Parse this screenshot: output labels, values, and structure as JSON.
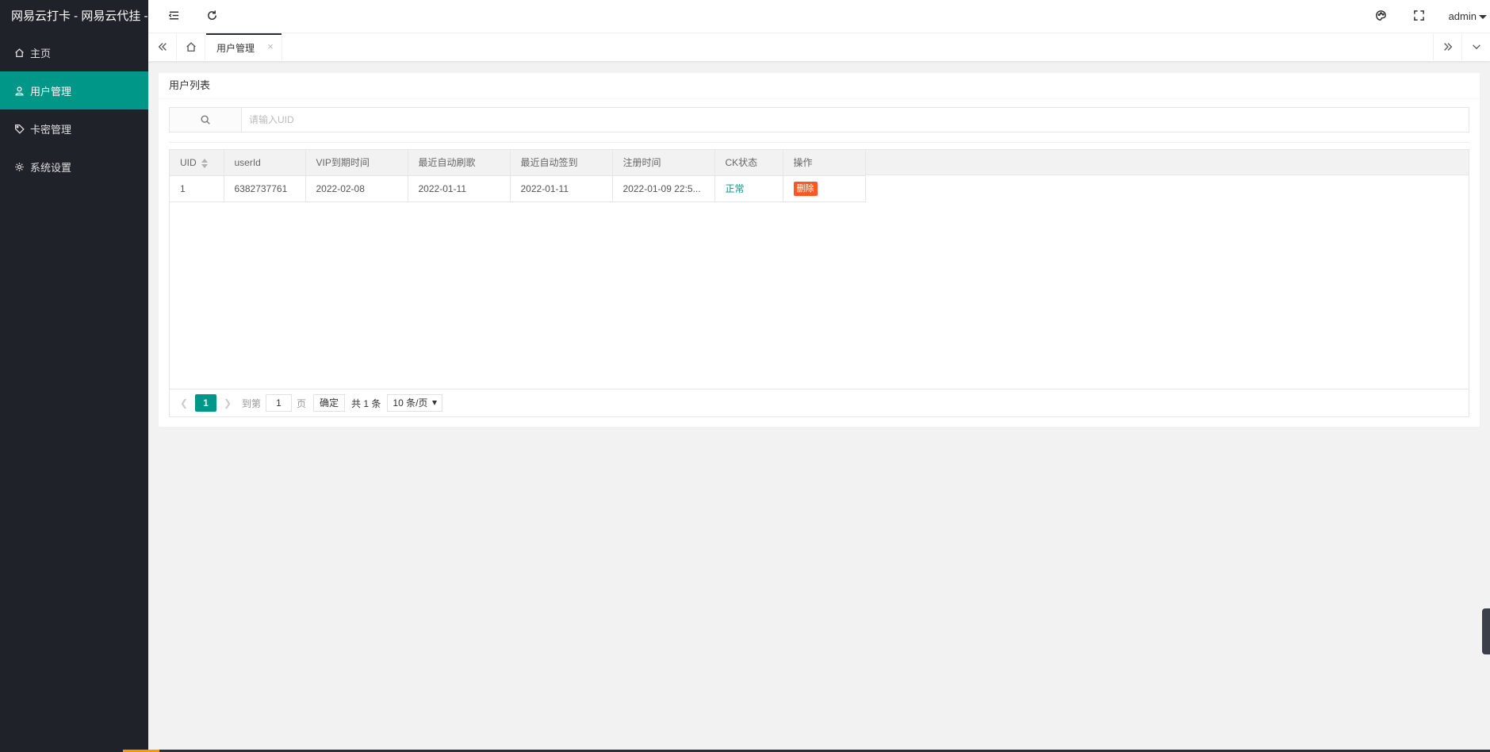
{
  "app": {
    "title": "网易云打卡 - 网易云代挂 -",
    "accent": "#009688",
    "danger": "#ff5722"
  },
  "sidebar": {
    "items": [
      {
        "label": "主页",
        "icon": "home-icon",
        "active": false
      },
      {
        "label": "用户管理",
        "icon": "user-icon",
        "active": true
      },
      {
        "label": "卡密管理",
        "icon": "tag-icon",
        "active": false
      },
      {
        "label": "系统设置",
        "icon": "gear-icon",
        "active": false
      }
    ]
  },
  "header": {
    "user": "admin"
  },
  "tabs": {
    "active_label": "用户管理"
  },
  "card": {
    "title": "用户列表"
  },
  "search": {
    "placeholder": "请输入UID",
    "value": ""
  },
  "table": {
    "columns": [
      "UID",
      "userId",
      "VIP到期时间",
      "最近自动刷歌",
      "最近自动签到",
      "注册时间",
      "CK状态",
      "操作"
    ],
    "rows": [
      {
        "uid": "1",
        "userId": "6382737761",
        "vip_expire": "2022-02-08",
        "last_auto_song": "2022-01-11",
        "last_auto_sign": "2022-01-11",
        "register_time": "2022-01-09 22:5...",
        "ck_status": "正常",
        "action": "删除"
      }
    ]
  },
  "pagination": {
    "current": "1",
    "goto_prefix": "到第",
    "goto_value": "1",
    "goto_suffix": "页",
    "confirm": "确定",
    "total": "共 1 条",
    "limit": "10 条/页"
  }
}
